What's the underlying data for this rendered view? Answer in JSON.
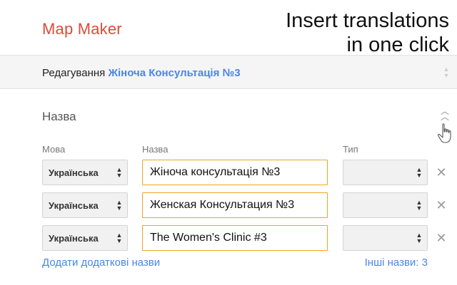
{
  "header": {
    "app_title": "Map Maker",
    "promo_line1": "Insert translations",
    "promo_line2": "in one click"
  },
  "edit_bar": {
    "prefix": "Редагування",
    "feature_name": "Жіноча Консультація №3"
  },
  "section": {
    "title": "Назва",
    "col_language": "Мова",
    "col_name": "Назва",
    "col_type": "Тип"
  },
  "rows": [
    {
      "language": "Українська",
      "name": "Жіноча консультація №3",
      "type": ""
    },
    {
      "language": "Українська",
      "name": "Женская Консультация №3",
      "type": ""
    },
    {
      "language": "Українська",
      "name": "The Women's Clinic #3",
      "type": ""
    }
  ],
  "footer": {
    "add_names": "Додати додаткові назви",
    "other_names": "Інші назви: 3"
  },
  "colors": {
    "brand": "#dd4b39",
    "link": "#4a86e8",
    "focus_border": "#f1a51e"
  },
  "icons": {
    "spinner": "up-down-chevrons",
    "remove": "close-x",
    "collapse": "double-chevron-up",
    "cursor": "hand-pointer"
  }
}
